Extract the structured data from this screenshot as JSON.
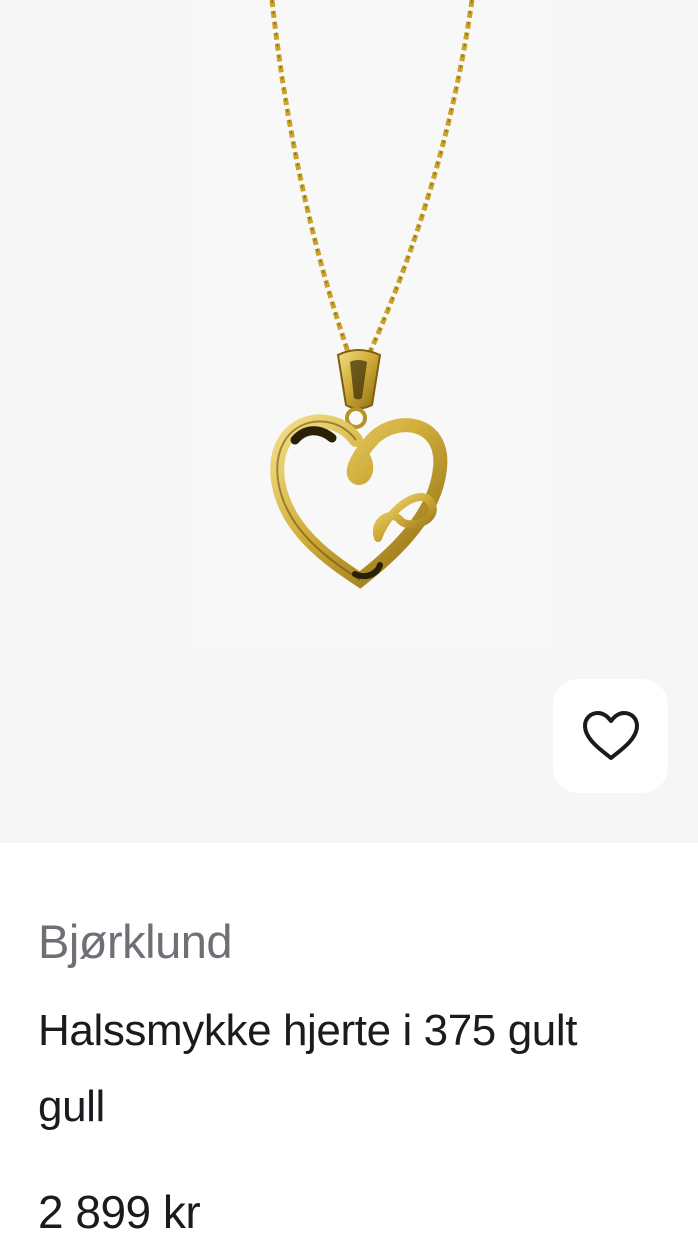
{
  "product": {
    "brand": "Bjørklund",
    "title": "Halssmykke hjerte i 375 gult gull",
    "price": "2 899 kr",
    "image_icon": "heart-pendant-necklace-image"
  },
  "favorite": {
    "icon": "heart-outline-icon"
  },
  "colors": {
    "image_background": "#f6f6f6",
    "gold": "#c9a227",
    "text_primary": "#1b1b1f",
    "text_secondary": "#6f6f76"
  }
}
